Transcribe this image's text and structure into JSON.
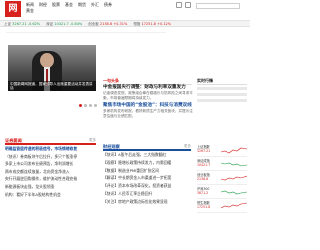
{
  "header": {
    "logo": "网",
    "nav": [
      "新闻",
      "财经",
      "股票",
      "基金",
      "期货",
      "外汇",
      "债券",
      "黄金"
    ]
  },
  "ticker": {
    "items": [
      {
        "label": "上证",
        "value": "3267.21",
        "change": "-0.62%",
        "dir": "down"
      },
      {
        "label": "深证",
        "value": "10421.7",
        "change": "-0.84%",
        "dir": "down"
      },
      {
        "label": "创业板",
        "value": "2138.8",
        "change": "+0.31%",
        "dir": "up"
      },
      {
        "label": "恒指",
        "value": "17251.8",
        "change": "+0.12%",
        "dir": "up"
      }
    ]
  },
  "hero": {
    "caption": "中国新闻网报道，国家领导人出席重要活动并发表讲话"
  },
  "mid": {
    "header": "一句头条",
    "items": [
      {
        "title": "中金报国央行调整：财政与利率双重发力",
        "body": "记者调查发现，政策组合拳在稳增长与防风险之间寻求平衡，市场普遍预期将持续发力。",
        "accent": false
      },
      {
        "title": "聚焦市场中国的“金股池”：科技与消费双线",
        "body": "多家机构发布研报，看好新质生产力相关板块，并提示注意估值与业绩匹配。",
        "accent": true
      }
    ]
  },
  "right": {
    "header": "实时行情"
  },
  "left_section": {
    "header": "证券要闻",
    "more": "更多",
    "lines": [
      "明确监管层传递的积极信号，市场情绪修复",
      "（快讯）券商板块午后拉升，多只个股涨停",
      "多家上市公司发布业绩预告，净利润增长",
      "两市成交额连续放量，北向资金净流入",
      "央行开展逆回购操作，维护流动性合理充裕",
      "新能源板块走强，龙头股领涨",
      "机构：看好下半年A股结构性机会"
    ]
  },
  "mid_section": {
    "header": "财经观察",
    "more": "更多",
    "lines": [
      "【快讯】A股午后走强，三大指数翻红",
      "【观察】稳增长政策持续发力，内需回暖",
      "【数据】制造业PMI重回扩张区间",
      "【解读】中长期资金入市渠道进一步拓宽",
      "【评论】资本市场改革深化，投资者获益",
      "【快讯】人民币汇率企稳回升",
      "【关注】房地产政策边际优化效果显现"
    ]
  },
  "right_section": {
    "cards": [
      {
        "label": "上证指数",
        "value": "3267.21"
      },
      {
        "label": "深证成指",
        "value": "10421.7"
      },
      {
        "label": "创业板指",
        "value": "2138.8"
      },
      {
        "label": "沪深300",
        "value": "3871.2"
      },
      {
        "label": "恒生指数",
        "value": "17251.8"
      }
    ]
  }
}
